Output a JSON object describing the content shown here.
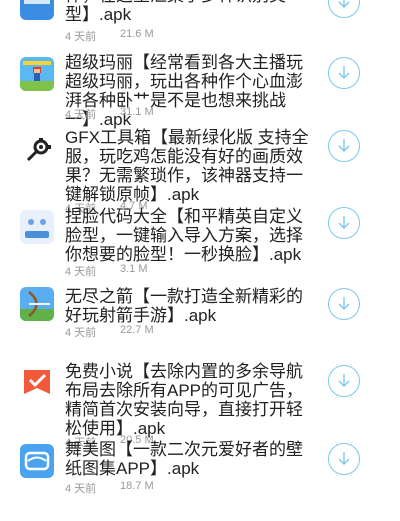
{
  "colors": {
    "accent": "#7ec7ee",
    "title": "#222222",
    "meta": "#999999"
  },
  "apps": [
    {
      "title": "件，在这里汇集了多种识别类型】.apk",
      "date": "4 天前",
      "size": "21.6 M",
      "icon": "blue-app-icon"
    },
    {
      "title": "超级玛丽【经常看到各大主播玩超级玛丽，玩出各种作个心血澎湃各种卧艹是不是也想来挑战一】.apk",
      "date": "4 天前",
      "size": "31.1 M",
      "icon": "mario-game-icon"
    },
    {
      "title": "GFX工具箱【最新绿化版 支持全服，玩吃鸡怎能没有好的画质效果？无需繁琐作，该神器支持一键解锁原帧】.apk",
      "date": "4 天前",
      "size": "4.7 M",
      "icon": "gear-tool-icon"
    },
    {
      "title": "捏脸代码大全【和平精英自定义脸型，一键输入导入方案，选择你想要的脸型！一秒换脸】.apk",
      "date": "4 天前",
      "size": "3.1 M",
      "icon": "face-code-icon"
    },
    {
      "title": "无尽之箭【一款打造全新精彩的好玩射箭手游】.apk",
      "date": "4 天前",
      "size": "22.7 M",
      "icon": "archery-game-icon"
    },
    {
      "title": "免费小说【去除内置的多余导航布局去除所有APP的可见广告，精简首次安装向导，直接打开轻松使用】.apk",
      "date": "4 天前",
      "size": "20.5 M",
      "icon": "novel-book-icon"
    },
    {
      "title": "舞美图【一款二次元爱好者的壁纸图集APP】.apk",
      "date": "4 天前",
      "size": "18.7 M",
      "icon": "wallpaper-app-icon"
    }
  ]
}
